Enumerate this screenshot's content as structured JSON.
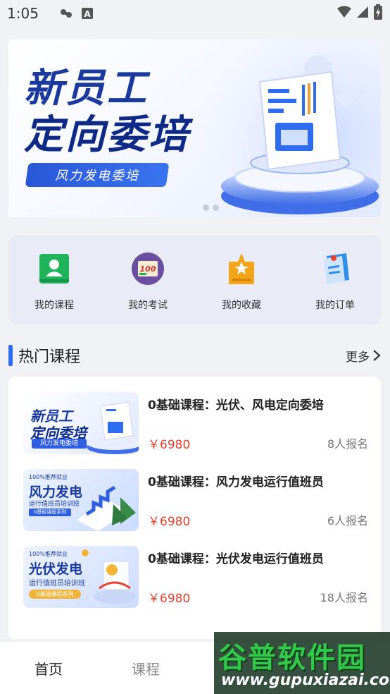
{
  "status_bar": {
    "time": "1:05"
  },
  "banner": {
    "title_line1": "新员工",
    "title_line2": "定向委培",
    "tag": "风力发电委培",
    "dots": 2
  },
  "quick_actions": [
    {
      "label": "我的课程",
      "icon": "course-book-icon",
      "color": "#1fb35a"
    },
    {
      "label": "我的考试",
      "icon": "exam-100-icon",
      "color": "#6a4fa0"
    },
    {
      "label": "我的收藏",
      "icon": "favorite-star-icon",
      "color": "#f2a41a"
    },
    {
      "label": "我的订单",
      "icon": "order-clipboard-icon",
      "color": "#2f8ee8"
    }
  ],
  "hot_courses": {
    "title": "热门课程",
    "more": "更多",
    "items": [
      {
        "title": "0基础课程：光伏、风电定向委培",
        "price": "￥6980",
        "enrolled": "8人报名",
        "thumb": {
          "line1": "新员工",
          "line2": "定向委培",
          "tag": "风力发电委培"
        }
      },
      {
        "title": "0基础课程：风力发电运行值班员",
        "price": "￥6980",
        "enrolled": "6人报名",
        "thumb": {
          "top": "100%推荐就业",
          "line1": "风力发电",
          "line2": "运行值班员培训班",
          "tag": "0基础课程系列"
        }
      },
      {
        "title": "0基础课程：光伏发电运行值班员",
        "price": "￥6980",
        "enrolled": "18人报名",
        "thumb": {
          "top": "100%推荐就业",
          "line1": "光伏发电",
          "line2": "运行值班员培训班",
          "tag": "0基础课程系列"
        }
      }
    ]
  },
  "tab_bar": [
    {
      "label": "首页",
      "active": true
    },
    {
      "label": "课程",
      "active": false
    },
    {
      "label": "",
      "active": false
    },
    {
      "label": "",
      "active": false
    }
  ],
  "watermark": {
    "line1": "谷普软件园",
    "line2": "www.gupuxiazai.com"
  },
  "colors": {
    "accent": "#2f6df0",
    "price": "#e8412e",
    "background": "#f1f2f6"
  }
}
